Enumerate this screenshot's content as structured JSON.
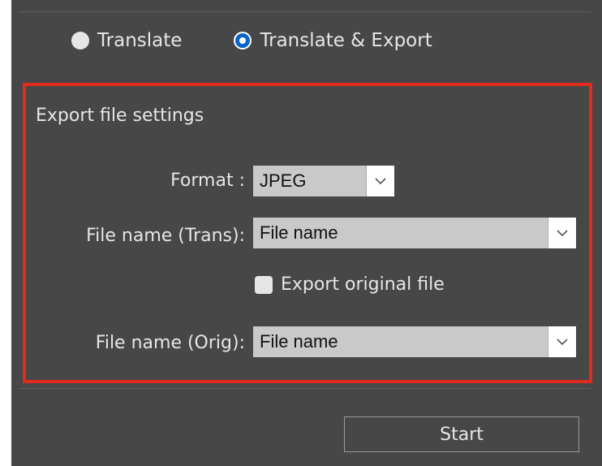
{
  "mode": {
    "options": [
      {
        "label": "Translate",
        "selected": false
      },
      {
        "label": "Translate & Export",
        "selected": true
      }
    ]
  },
  "export_settings": {
    "title": "Export file settings",
    "format": {
      "label": "Format :",
      "value": "JPEG"
    },
    "trans_name": {
      "label": "File name (Trans):",
      "value": "File name"
    },
    "export_original": {
      "label": "Export original file",
      "checked": false
    },
    "orig_name": {
      "label": "File name (Orig):",
      "value": "File name"
    }
  },
  "actions": {
    "start_label": "Start"
  },
  "colors": {
    "panel_bg": "#474747",
    "highlight_border": "#e12b1e",
    "radio_selected": "#0a64c8"
  }
}
